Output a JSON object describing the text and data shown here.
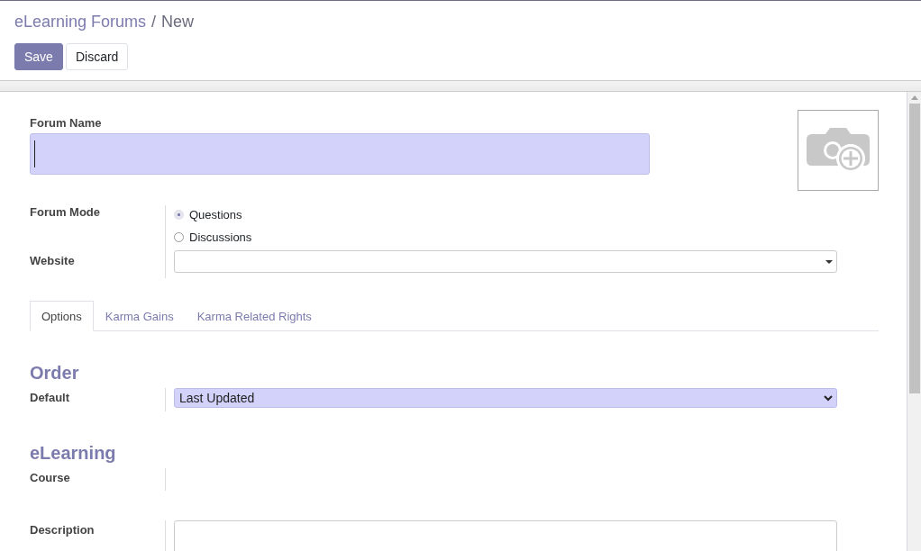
{
  "breadcrumb": {
    "parent": "eLearning Forums",
    "separator": "/",
    "current": "New"
  },
  "buttons": [
    {
      "label": "Save",
      "kind": "primary"
    },
    {
      "label": "Discard",
      "kind": "secondary"
    }
  ],
  "forum_name": {
    "label": "Forum Name",
    "focused": true
  },
  "forum_mode": {
    "label": "Forum Mode",
    "options": [
      {
        "label": "Questions",
        "selected": true
      },
      {
        "label": "Discussions",
        "selected": false
      }
    ]
  },
  "website": {
    "label": "Website"
  },
  "tabs": [
    {
      "label": "Options",
      "selected": true
    },
    {
      "label": "Karma Gains",
      "selected": false
    },
    {
      "label": "Karma Related Rights",
      "selected": false
    }
  ],
  "sections": [
    {
      "title": "Order",
      "fields": [
        {
          "label": "Default",
          "kind": "select",
          "value": "Last Updated"
        }
      ]
    },
    {
      "title": "eLearning",
      "fields": [
        {
          "label": "Course",
          "kind": "empty"
        },
        {
          "label": "Description",
          "kind": "textarea"
        }
      ]
    }
  ]
}
